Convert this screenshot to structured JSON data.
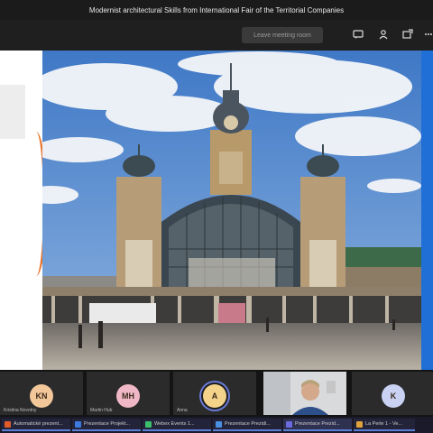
{
  "window": {
    "title": "Modernist architectural Skills from International Fair of the Territorial Companies"
  },
  "toolbar": {
    "button_label": "Leave meeting room",
    "icons": [
      "chat-icon",
      "people-icon",
      "share-icon",
      "more-icon"
    ],
    "labels": [
      "",
      "",
      "",
      ""
    ]
  },
  "participants": [
    {
      "initials": "KN",
      "name": "Kristina Novotny",
      "avatar_color": "#f2c79a"
    },
    {
      "initials": "MH",
      "name": "Martin Hub",
      "avatar_color": "#f0b8c6"
    },
    {
      "initials": "A",
      "name": "Anna",
      "avatar_color": "#f3d28a",
      "active": true
    },
    {
      "initials": "",
      "name": "",
      "video": true
    },
    {
      "initials": "K",
      "name": "",
      "avatar_color": "#c9d2f3"
    }
  ],
  "taskbar": [
    {
      "label": "Automatické prezent...",
      "color": "#e05a2a"
    },
    {
      "label": "Prezentace Projekt...",
      "color": "#3b7be0"
    },
    {
      "label": "Webex Events 1...",
      "color": "#3bbf6a"
    },
    {
      "label": "Prezentace Prezidi...",
      "color": "#4a90e2"
    },
    {
      "label": "Prezentace Prezid...",
      "color": "#6a6ae0"
    },
    {
      "label": "La Perle 1 - Ve...",
      "color": "#e0a23b"
    }
  ]
}
